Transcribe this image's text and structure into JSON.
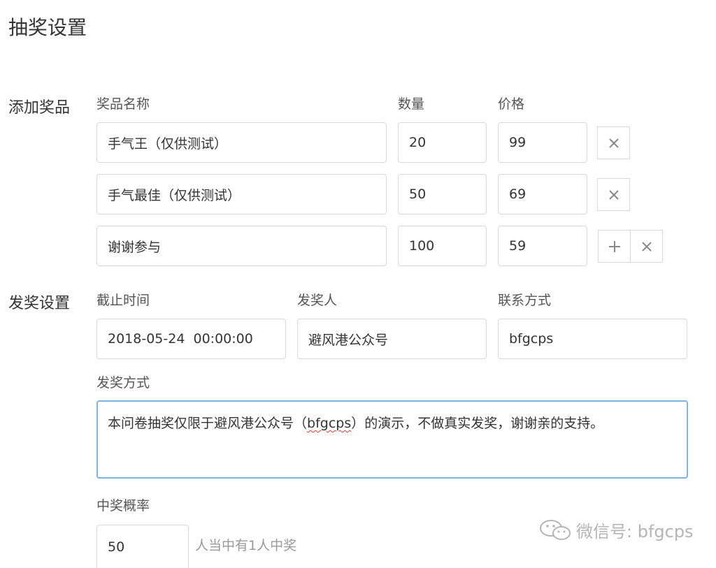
{
  "page": {
    "title": "抽奖设置"
  },
  "prizes": {
    "section_label": "添加奖品",
    "headers": {
      "name": "奖品名称",
      "quantity": "数量",
      "price": "价格"
    },
    "rows": [
      {
        "name": "手气王（仅供测试）",
        "quantity": "20",
        "price": "99"
      },
      {
        "name": "手气最佳（仅供测试）",
        "quantity": "50",
        "price": "69"
      },
      {
        "name": "谢谢参与",
        "quantity": "100",
        "price": "59"
      }
    ],
    "add_icon": "plus-icon",
    "remove_icon": "close-icon"
  },
  "award": {
    "section_label": "发奖设置",
    "deadline_label": "截止时间",
    "deadline_value": "2018-05-24  00:00:00",
    "issuer_label": "发奖人",
    "issuer_value": "避风港公众号",
    "contact_label": "联系方式",
    "contact_value": "bfgcps",
    "method_label": "发奖方式",
    "method_text_before": "本问卷抽奖仅限于避风港公众号（",
    "method_text_flagged": "bfgcps",
    "method_text_after": "）的演示，不做真实发奖，谢谢亲的支持。",
    "probability_label": "中奖概率",
    "probability_value": "50",
    "probability_hint": "人当中有1人中奖"
  },
  "watermark": {
    "text": "微信号: bfgcps",
    "icon": "wechat-icon"
  },
  "colors": {
    "focus_border": "#7fb3e0",
    "input_border": "#d9d9d9",
    "spell_underline": "#e53935"
  }
}
